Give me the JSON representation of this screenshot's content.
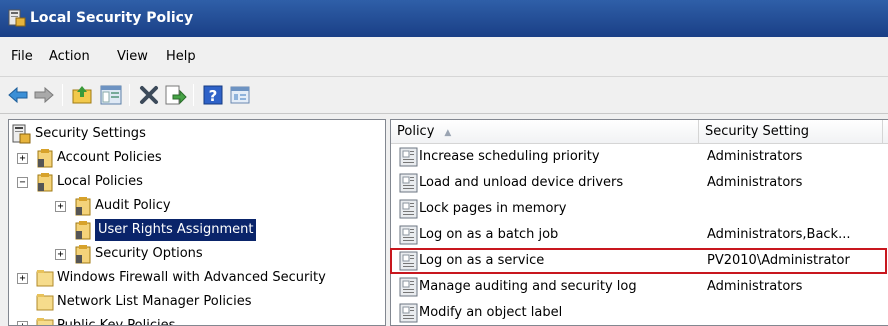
{
  "window": {
    "title": "Local Security Policy"
  },
  "menu": [
    "File",
    "Action",
    "View",
    "Help"
  ],
  "toolbar": [
    "back-icon",
    "forward-icon",
    "up-folder-icon",
    "show-hide-tree-icon",
    "delete-icon",
    "export-list-icon",
    "help-icon",
    "properties-icon"
  ],
  "tree": {
    "root": "Security Settings",
    "nodes": [
      {
        "label": "Account Policies",
        "expander": "+"
      },
      {
        "label": "Local Policies",
        "expander": "−"
      },
      {
        "label": "Audit Policy",
        "expander": "+"
      },
      {
        "label": "User Rights Assignment",
        "expander": ""
      },
      {
        "label": "Security Options",
        "expander": "+"
      },
      {
        "label": "Windows Firewall with Advanced Security",
        "expander": "+"
      },
      {
        "label": "Network List Manager Policies",
        "expander": ""
      },
      {
        "label": "Public Key Policies",
        "expander": "+"
      }
    ]
  },
  "list": {
    "columns": {
      "policy": "Policy",
      "setting": "Security Setting"
    },
    "rows": [
      {
        "policy": "Increase scheduling priority",
        "setting": "Administrators"
      },
      {
        "policy": "Load and unload device drivers",
        "setting": "Administrators"
      },
      {
        "policy": "Lock pages in memory",
        "setting": ""
      },
      {
        "policy": "Log on as a batch job",
        "setting": "Administrators,Back..."
      },
      {
        "policy": "Log on as a service",
        "setting": "PV2010\\Administrator"
      },
      {
        "policy": "Manage auditing and security log",
        "setting": "Administrators"
      },
      {
        "policy": "Modify an object label",
        "setting": ""
      }
    ]
  },
  "colors": {
    "highlight": "#c8171e",
    "selection": "#0a246a"
  }
}
